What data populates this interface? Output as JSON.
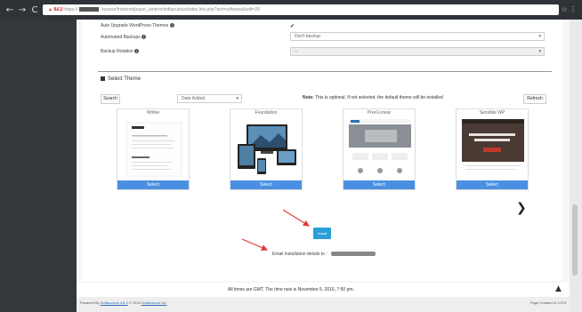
{
  "browser": {
    "back": "←",
    "forward": "→",
    "reload": "C",
    "secure_warning": "▲ 8&1/",
    "url_text": "https://",
    "url_rest": "/cpsess/frontend/paper_lantern/softaculous/index.live.php?act=software&soft=26",
    "bar_icons": "☆ ⋮"
  },
  "form": {
    "auto_upgrade_themes_label": "Auto Upgrade WordPress Themes",
    "auto_upgrade_checked": "✔",
    "automated_backups_label": "Automated Backups",
    "automated_backups_value": "Don't backup",
    "backup_rotation_label": "Backup Rotation",
    "backup_rotation_value": "--",
    "info_icon": "i"
  },
  "theme_section": {
    "title": "Select Theme",
    "search_label": "Search",
    "sort_value": "Date Added",
    "note_bold": "Note:",
    "note_text": " This is optional. If not selected, the default theme will be installed",
    "refresh_label": "Refresh",
    "themes": [
      {
        "name": "Writee",
        "select": "Select"
      },
      {
        "name": "Foundation",
        "select": "Select"
      },
      {
        "name": "Pixel-Linear",
        "select": "Select"
      },
      {
        "name": "Sensible WP",
        "select": "Select"
      }
    ],
    "next_icon": "❯"
  },
  "install": {
    "button_label": "Install",
    "email_label": "Email installation details to :"
  },
  "footer": {
    "message": "All times are GMT. The time now is November 5, 2016, 7:50 pm.",
    "powered_prefix": "Powered By ",
    "powered_link": "Softaculous 4.8.3",
    "copyright_prefix": " © 2016 ",
    "copyright_link": "Softaculous Ltd.",
    "page_created": "Page Created In 0.073",
    "scroll_top_icon": "▲"
  },
  "colors": {
    "select_button": "#4a90e2",
    "install_button": "#2aa0d8",
    "annotation_arrow": "#e23b3b"
  }
}
